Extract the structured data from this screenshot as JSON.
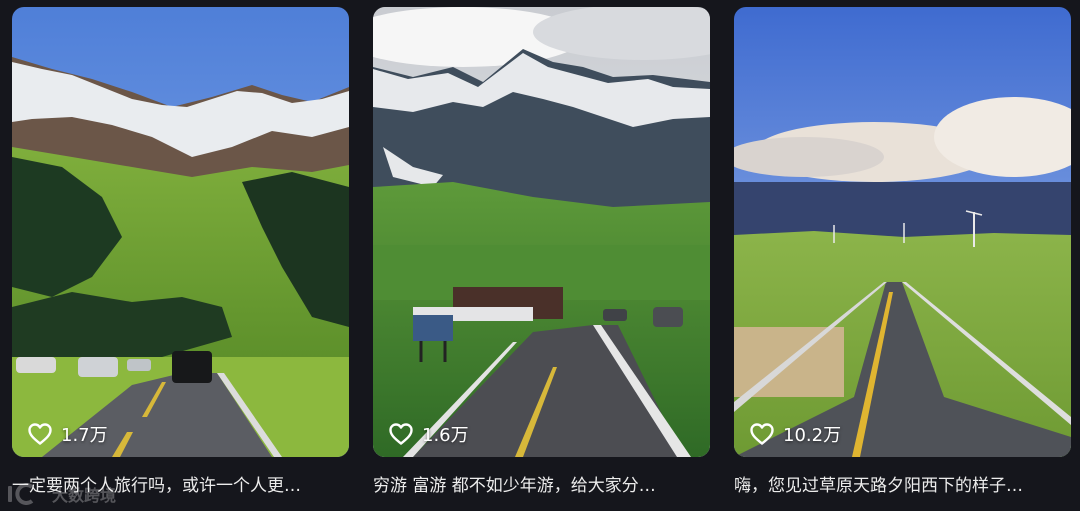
{
  "cards": [
    {
      "likes": "1.7万",
      "caption": "一定要两个人旅行吗，或许一个人更…"
    },
    {
      "likes": "1.6万",
      "caption": "穷游 富游 都不如少年游，给大家分…"
    },
    {
      "likes": "10.2万",
      "caption": "嗨，您见过草原天路夕阳西下的样子…"
    }
  ],
  "watermark": {
    "text": "大数跨境",
    "icon": "ic-logo-icon"
  },
  "icons": {
    "like": "heart-outline-icon"
  },
  "colors": {
    "background": "#15161c",
    "caption_text": "#ececec",
    "likes_text": "#ffffff"
  }
}
